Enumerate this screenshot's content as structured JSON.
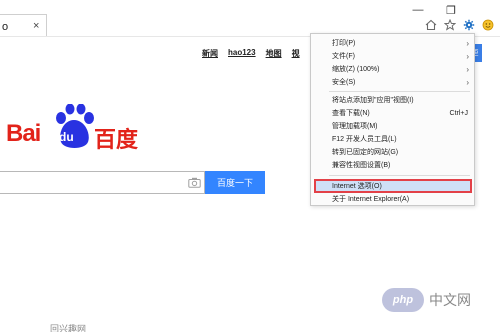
{
  "tab": {
    "title": "o",
    "close": "×"
  },
  "window": {
    "minimize": "—",
    "restore": "❐"
  },
  "toolbar": {
    "icons": [
      "home-icon",
      "star-icon",
      "gear-icon",
      "smile-icon"
    ]
  },
  "baidu": {
    "nav": [
      "新闻",
      "hao123",
      "地图",
      "视"
    ],
    "right_button": "更",
    "logo": {
      "bai": "Bai",
      "du": "du",
      "cn": "百度"
    },
    "search_button": "百度一下"
  },
  "menu": {
    "items": [
      {
        "label": "打印(P)",
        "arrow": "›"
      },
      {
        "label": "文件(F)",
        "arrow": "›"
      },
      {
        "label": "缩放(Z) (100%)",
        "arrow": "›"
      },
      {
        "label": "安全(S)",
        "arrow": "›"
      },
      {
        "label": "将站点添加到\"应用\"视图(I)"
      },
      {
        "label": "查看下载(N)",
        "shortcut": "Ctrl+J"
      },
      {
        "label": "管理加载项(M)"
      },
      {
        "label": "F12 开发人员工具(L)"
      },
      {
        "label": "转到已固定的网站(G)"
      },
      {
        "label": "兼容性视图设置(B)"
      },
      {
        "label": "Internet 选项(O)"
      },
      {
        "label": "关于 Internet Explorer(A)"
      }
    ]
  },
  "watermark": {
    "php": "php",
    "cn": "中文网"
  },
  "bottom_text": "回兴趣网"
}
